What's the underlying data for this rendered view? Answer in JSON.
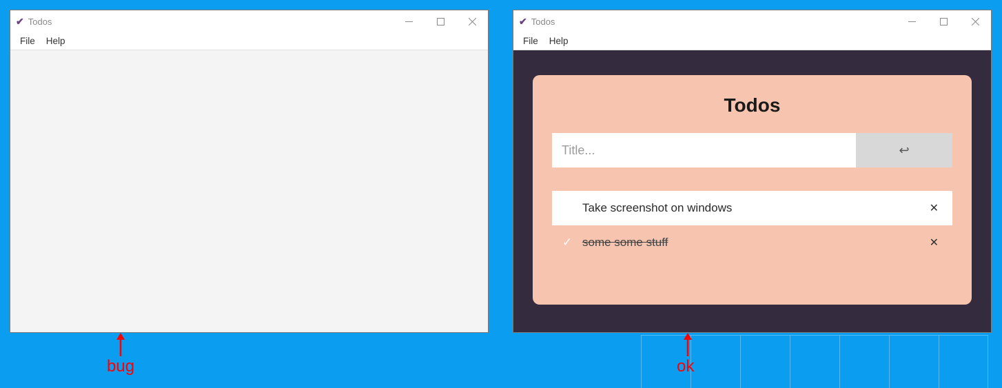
{
  "windows": {
    "left": {
      "title": "Todos",
      "menu": {
        "file": "File",
        "help": "Help"
      }
    },
    "right": {
      "title": "Todos",
      "menu": {
        "file": "File",
        "help": "Help"
      },
      "card": {
        "heading": "Todos",
        "input_placeholder": "Title...",
        "items": [
          {
            "text": "Take screenshot on windows",
            "done": false
          },
          {
            "text": "some some stuff",
            "done": true
          }
        ]
      }
    }
  },
  "annotations": {
    "bug": "bug",
    "ok": "ok"
  }
}
